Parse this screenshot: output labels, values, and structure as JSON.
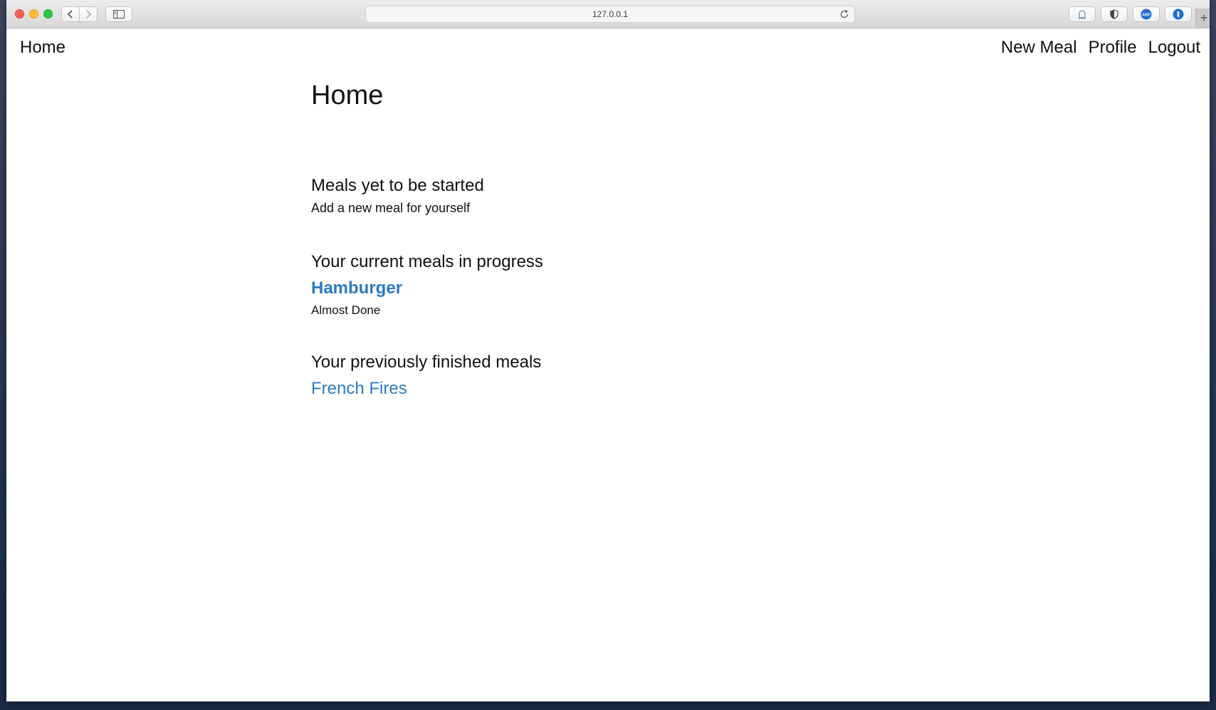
{
  "browser": {
    "url": "127.0.0.1"
  },
  "nav": {
    "home": "Home",
    "links": [
      "New Meal",
      "Profile",
      "Logout"
    ]
  },
  "page": {
    "title": "Home",
    "sections": {
      "not_started": {
        "heading": "Meals yet to be started",
        "text": "Add a new meal for yourself"
      },
      "in_progress": {
        "heading": "Your current meals in progress",
        "meal": "Hamburger",
        "status": "Almost Done"
      },
      "finished": {
        "heading": "Your previously finished meals",
        "meal": "French Fires"
      }
    }
  },
  "colors": {
    "link": "#2a7ac7"
  }
}
